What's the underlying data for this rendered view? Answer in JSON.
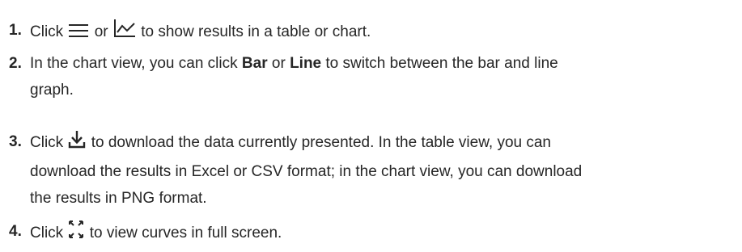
{
  "steps": [
    {
      "number": "1.",
      "click": "Click",
      "or": "or",
      "rest": "to show results in a table or chart.",
      "icons": [
        "list-view-icon",
        "chart-view-icon"
      ]
    },
    {
      "number": "2.",
      "before": "In the chart view, you can click",
      "bar": "Bar",
      "or": "or",
      "line": "Line",
      "after": "to switch between the bar and line",
      "after2": "graph."
    },
    {
      "number": "3.",
      "click": "Click",
      "line1": "to download the data currently presented. In the table view, you can",
      "line2": "download the results in Excel or CSV format; in the chart view, you can download",
      "line3": "the results in PNG format.",
      "icon": "download-icon"
    },
    {
      "number": "4.",
      "click": "Click",
      "rest": "to view curves in full screen.",
      "icon": "fullscreen-icon"
    }
  ],
  "colors": {
    "text": "#262626"
  }
}
